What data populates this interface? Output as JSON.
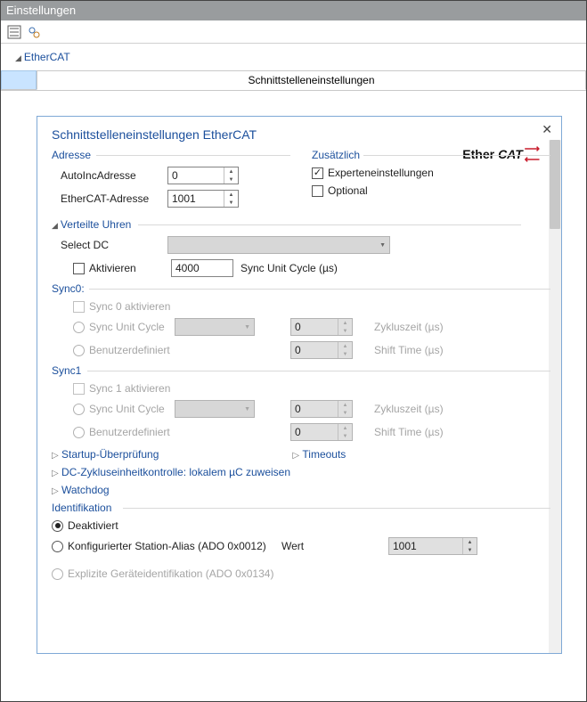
{
  "window_title": "Einstellungen",
  "breadcrumb": "EtherCAT",
  "tab_active": "Schnittstelleneinstellungen",
  "panel": {
    "title": "Schnittstelleneinstellungen EtherCAT",
    "sections": {
      "address": {
        "heading": "Adresse",
        "auto_inc_label": "AutoIncAdresse",
        "auto_inc_value": "0",
        "ethercat_addr_label": "EtherCAT-Adresse",
        "ethercat_addr_value": "1001"
      },
      "additional": {
        "heading": "Zusätzlich",
        "expert_label": "Experteneinstellungen",
        "optional_label": "Optional"
      },
      "dc": {
        "heading": "Verteilte Uhren",
        "select_label": "Select DC",
        "activate_label": "Aktivieren",
        "cycle_value": "4000",
        "cycle_unit": "Sync Unit Cycle (µs)"
      },
      "sync0": {
        "heading": "Sync0:",
        "activate_label": "Sync 0 aktivieren",
        "option_cycle": "Sync Unit Cycle",
        "option_user": "Benutzerdefiniert",
        "cycle_value": "0",
        "shift_value": "0",
        "cycle_time_label": "Zykluszeit (µs)",
        "shift_time_label": "Shift Time (µs)"
      },
      "sync1": {
        "heading": "Sync1",
        "activate_label": "Sync 1 aktivieren",
        "option_cycle": "Sync Unit Cycle",
        "option_user": "Benutzerdefiniert",
        "cycle_value": "0",
        "shift_value": "0",
        "cycle_time_label": "Zykluszeit (µs)",
        "shift_time_label": "Shift Time (µs)"
      },
      "expanders": {
        "startup": "Startup-Überprüfung",
        "timeouts": "Timeouts",
        "dc_control": "DC-Zykluseinheitkontrolle: lokalem µC zuweisen",
        "watchdog": "Watchdog"
      },
      "identification": {
        "heading": "Identifikation",
        "disabled_label": "Deaktiviert",
        "alias_label": "Konfigurierter Station-Alias (ADO 0x0012)",
        "value_label": "Wert",
        "value": "1001",
        "explicit_label": "Explizite Geräteidentifikation (ADO 0x0134)"
      }
    },
    "logo": {
      "a": "Ether",
      "b": "CAT"
    }
  }
}
